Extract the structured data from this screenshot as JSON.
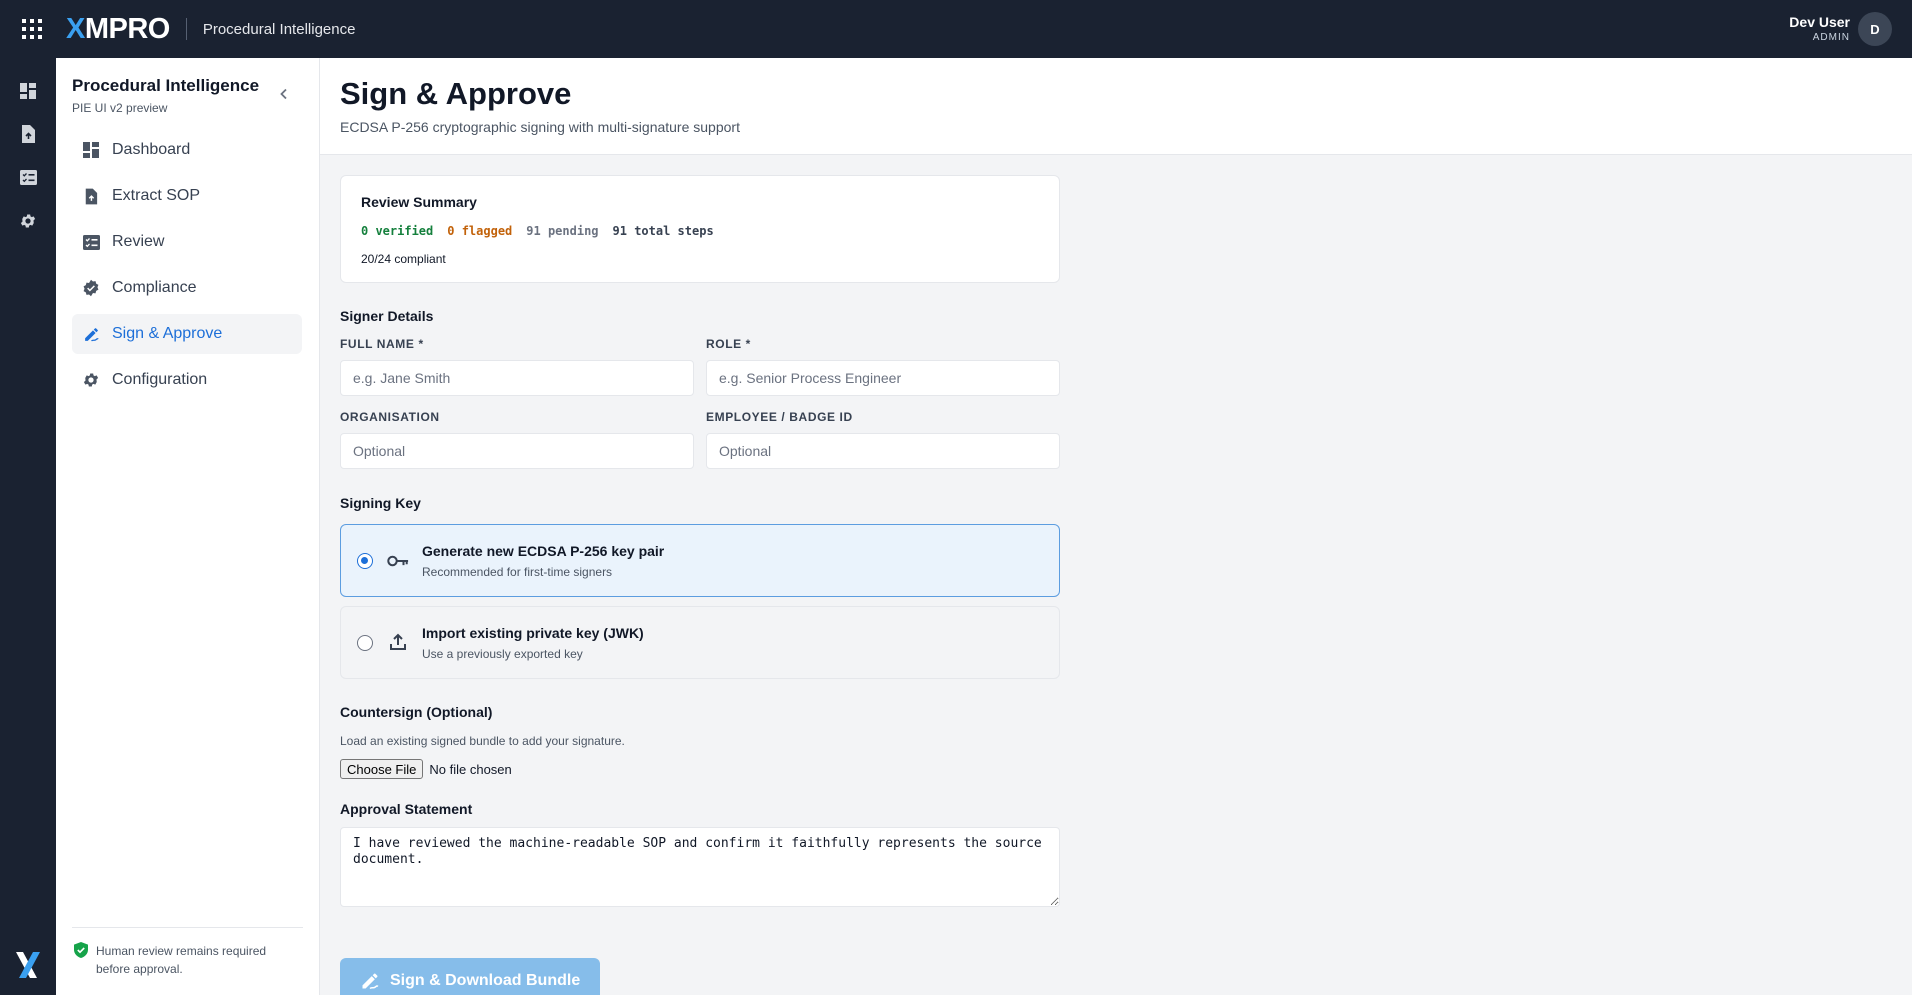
{
  "topbar": {
    "logo": "XMPRO",
    "app_name": "Procedural Intelligence",
    "user_name": "Dev User",
    "user_role": "ADMIN",
    "avatar_initial": "D"
  },
  "rail": {
    "items": [
      "dashboard-icon",
      "extract-icon",
      "review-icon",
      "settings-icon"
    ]
  },
  "sidebar": {
    "title": "Procedural Intelligence",
    "subtitle": "PIE UI v2 preview",
    "items": [
      {
        "label": "Dashboard",
        "icon": "dashboard-icon"
      },
      {
        "label": "Extract SOP",
        "icon": "file-upload-icon"
      },
      {
        "label": "Review",
        "icon": "review-icon"
      },
      {
        "label": "Compliance",
        "icon": "verified-badge-icon"
      },
      {
        "label": "Sign & Approve",
        "icon": "signature-icon",
        "active": true
      },
      {
        "label": "Configuration",
        "icon": "gear-icon"
      }
    ],
    "footer": "Human review remains required before approval."
  },
  "page": {
    "title": "Sign & Approve",
    "subtitle": "ECDSA P-256 cryptographic signing with multi-signature support"
  },
  "review_summary": {
    "title": "Review Summary",
    "verified": "0 verified",
    "flagged": "0 flagged",
    "pending": "91 pending",
    "total": "91 total steps",
    "compliant": "20/24 compliant"
  },
  "signer": {
    "section": "Signer Details",
    "full_name_label": "FULL NAME *",
    "full_name_placeholder": "e.g. Jane Smith",
    "role_label": "ROLE *",
    "role_placeholder": "e.g. Senior Process Engineer",
    "org_label": "ORGANISATION",
    "org_placeholder": "Optional",
    "badge_label": "EMPLOYEE / BADGE ID",
    "badge_placeholder": "Optional"
  },
  "signing_key": {
    "section": "Signing Key",
    "options": [
      {
        "title": "Generate new ECDSA P-256 key pair",
        "sub": "Recommended for first-time signers",
        "icon": "key-icon",
        "selected": true
      },
      {
        "title": "Import existing private key (JWK)",
        "sub": "Use a previously exported key",
        "icon": "upload-icon",
        "selected": false
      }
    ]
  },
  "countersign": {
    "section": "Countersign (Optional)",
    "help": "Load an existing signed bundle to add your signature.",
    "choose_label": "Choose File",
    "no_file": "No file chosen"
  },
  "approval": {
    "section": "Approval Statement",
    "text": "I have reviewed the machine-readable SOP and confirm it faithfully represents the source document."
  },
  "actions": {
    "sign_label": "Sign & Download Bundle"
  },
  "colors": {
    "topbar": "#1a2231",
    "accent": "#1d6fd8",
    "verified": "#15803d",
    "flagged": "#c2620a",
    "button_disabled": "#86bdea"
  }
}
